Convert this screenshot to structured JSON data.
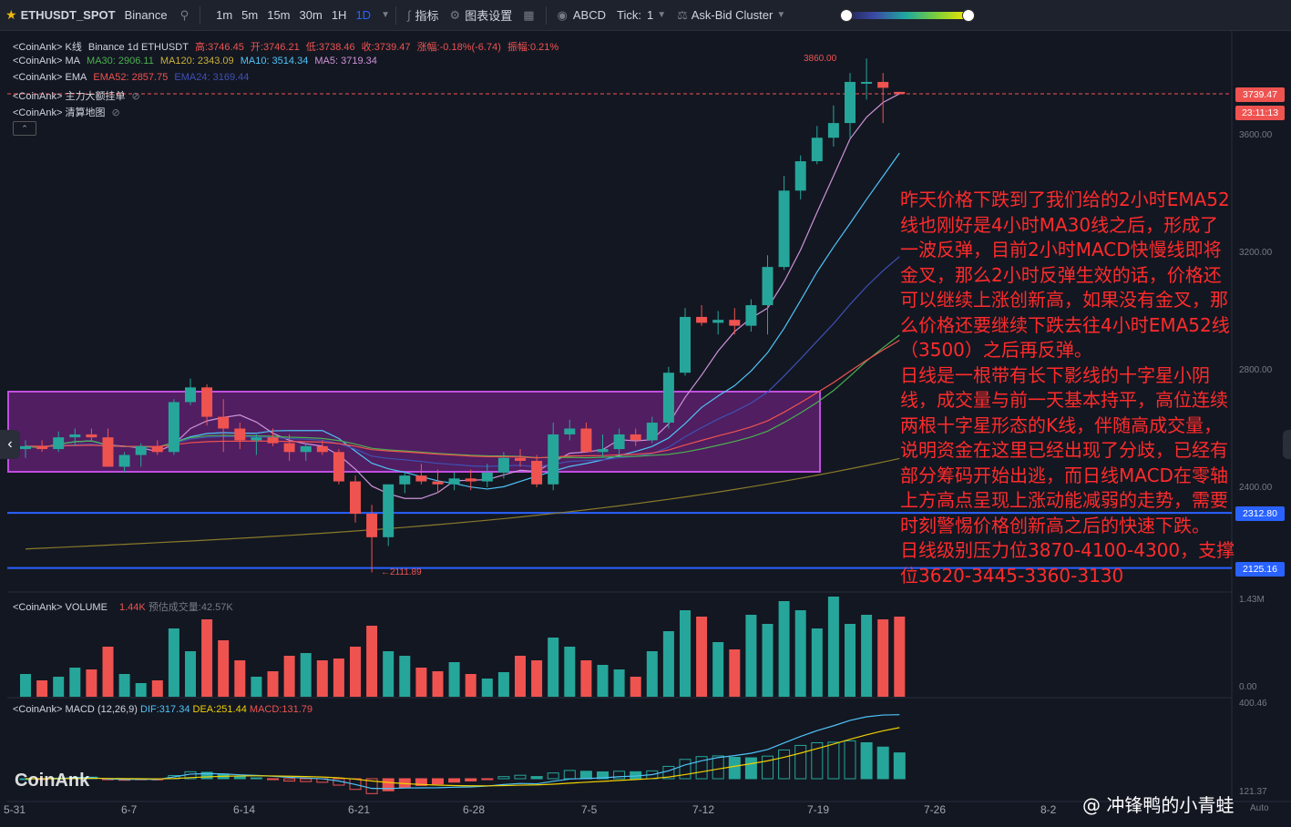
{
  "toolbar": {
    "symbol": "ETHUSDT_SPOT",
    "exchange": "Binance",
    "timeframes": [
      "1m",
      "5m",
      "15m",
      "30m",
      "1H",
      "1D"
    ],
    "active_timeframe": "1D",
    "indicators_label": "指标",
    "settings_label": "图表设置",
    "abcd_label": "ABCD",
    "tick_label": "Tick:",
    "tick_value": "1",
    "cluster_label": "Ask-Bid Cluster"
  },
  "legends": {
    "kline": {
      "prefix": "<CoinAnk> K线",
      "source": "Binance 1d ETHUSDT",
      "high": "高:3746.45",
      "open": "开:3746.21",
      "low": "低:3738.46",
      "close": "收:3739.47",
      "change": "涨幅:-0.18%(-6.74)",
      "amplitude": "振幅:0.21%"
    },
    "ma": {
      "prefix": "<CoinAnk> MA",
      "ma30": "MA30: 2906.11",
      "ma120": "MA120: 2343.09",
      "ma10": "MA10: 3514.34",
      "ma5": "MA5: 3719.34"
    },
    "ema": {
      "prefix": "<CoinAnk> EMA",
      "ema52": "EMA52: 2857.75",
      "ema24": "EMA24: 3169.44"
    },
    "orders": {
      "prefix": "<CoinAnk> 主力大额挂单"
    },
    "liq": {
      "prefix": "<CoinAnk> 清算地图"
    },
    "volume": {
      "prefix": "<CoinAnk> VOLUME",
      "value": "1.44K",
      "estimate": "预估成交量:42.57K"
    },
    "macd": {
      "prefix": "<CoinAnk> MACD",
      "params": "(12,26,9)",
      "dif": "DIF:317.34",
      "dea": "DEA:251.44",
      "macd": "MACD:131.79"
    }
  },
  "price_tags": {
    "last_price": "3739.47",
    "countdown": "23:11:13",
    "level_1": "2312.80",
    "level_2": "2125.16",
    "high_mark": "3860.00",
    "low_mark": "2111.89"
  },
  "price_axis": [
    "3600.00",
    "3200.00",
    "2800.00",
    "2400.00"
  ],
  "volume_axis": [
    "1.43M",
    "0.00"
  ],
  "macd_axis": [
    "400.46",
    "121.37"
  ],
  "date_axis": [
    "5-31",
    "6-7",
    "6-14",
    "6-21",
    "6-28",
    "7-5",
    "7-12",
    "7-19",
    "7-26",
    "8-2",
    "Auto"
  ],
  "annotation": [
    "昨天价格下跌到了我们给的2小时EMA52线也刚好是4小时MA30线之后，形成了一波反弹，目前2小时MACD快慢线即将金叉，那么2小时反弹生效的话，价格还可以继续上涨创新高，如果没有金叉，那么价格还要继续下跌去往4小时EMA52线（3500）之后再反弹。",
    "日线是一根带有长下影线的十字星小阴线，成交量与前一天基本持平，高位连续两根十字星形态的K线，伴随高成交量，说明资金在这里已经出现了分歧，已经有部分筹码开始出逃，而日线MACD在零轴上方高点呈现上涨动能减弱的走势，需要时刻警惕价格创新高之后的快速下跌。",
    "日线级别压力位3870-4100-4300，支撑位3620-3445-3360-3130"
  ],
  "logo_text": "CoinAnk",
  "watermark": "@ 冲锋鸭的小青蛙",
  "colors": {
    "up": "#26a69a",
    "down": "#ef5350",
    "box": "#9c27b0",
    "support_line": "#2962ff"
  },
  "chart_data": {
    "type": "candlestick",
    "x": [
      "5-31",
      "6-1",
      "6-2",
      "6-3",
      "6-4",
      "6-5",
      "6-6",
      "6-7",
      "6-8",
      "6-9",
      "6-10",
      "6-11",
      "6-12",
      "6-13",
      "6-14",
      "6-15",
      "6-16",
      "6-17",
      "6-18",
      "6-19",
      "6-20",
      "6-21",
      "6-22",
      "6-23",
      "6-24",
      "6-25",
      "6-26",
      "6-27",
      "6-28",
      "6-29",
      "6-30",
      "7-1",
      "7-2",
      "7-3",
      "7-4",
      "7-5",
      "7-6",
      "7-7",
      "7-8",
      "7-9",
      "7-10",
      "7-11",
      "7-12",
      "7-13",
      "7-14",
      "7-15",
      "7-16",
      "7-17",
      "7-18",
      "7-19",
      "7-20",
      "7-21",
      "7-22",
      "7-23"
    ],
    "candles": [
      [
        2530,
        2560,
        2500,
        2540
      ],
      [
        2540,
        2560,
        2520,
        2530
      ],
      [
        2530,
        2590,
        2520,
        2570
      ],
      [
        2570,
        2600,
        2540,
        2580
      ],
      [
        2580,
        2600,
        2560,
        2570
      ],
      [
        2570,
        2600,
        2470,
        2470
      ],
      [
        2470,
        2520,
        2450,
        2510
      ],
      [
        2510,
        2550,
        2470,
        2540
      ],
      [
        2540,
        2560,
        2510,
        2520
      ],
      [
        2520,
        2700,
        2510,
        2690
      ],
      [
        2690,
        2770,
        2680,
        2740
      ],
      [
        2740,
        2750,
        2610,
        2640
      ],
      [
        2640,
        2700,
        2520,
        2600
      ],
      [
        2600,
        2620,
        2530,
        2560
      ],
      [
        2560,
        2580,
        2510,
        2570
      ],
      [
        2570,
        2600,
        2540,
        2550
      ],
      [
        2550,
        2580,
        2490,
        2520
      ],
      [
        2520,
        2550,
        2490,
        2540
      ],
      [
        2540,
        2560,
        2510,
        2520
      ],
      [
        2520,
        2530,
        2410,
        2420
      ],
      [
        2420,
        2440,
        2280,
        2310
      ],
      [
        2310,
        2340,
        2110,
        2230
      ],
      [
        2230,
        2380,
        2200,
        2410
      ],
      [
        2410,
        2450,
        2380,
        2440
      ],
      [
        2440,
        2480,
        2410,
        2420
      ],
      [
        2420,
        2460,
        2380,
        2410
      ],
      [
        2410,
        2450,
        2390,
        2430
      ],
      [
        2430,
        2460,
        2390,
        2420
      ],
      [
        2420,
        2480,
        2400,
        2450
      ],
      [
        2450,
        2520,
        2430,
        2500
      ],
      [
        2500,
        2530,
        2470,
        2490
      ],
      [
        2490,
        2510,
        2400,
        2410
      ],
      [
        2410,
        2620,
        2390,
        2580
      ],
      [
        2580,
        2630,
        2560,
        2600
      ],
      [
        2600,
        2620,
        2520,
        2520
      ],
      [
        2520,
        2580,
        2500,
        2530
      ],
      [
        2530,
        2600,
        2510,
        2580
      ],
      [
        2580,
        2600,
        2540,
        2560
      ],
      [
        2560,
        2640,
        2550,
        2620
      ],
      [
        2620,
        2810,
        2600,
        2790
      ],
      [
        2790,
        3010,
        2780,
        2980
      ],
      [
        2980,
        3020,
        2950,
        2960
      ],
      [
        2960,
        3000,
        2920,
        2970
      ],
      [
        2970,
        3010,
        2920,
        2950
      ],
      [
        2950,
        3040,
        2930,
        3020
      ],
      [
        3020,
        3190,
        2920,
        3150
      ],
      [
        3150,
        3460,
        3140,
        3410
      ],
      [
        3410,
        3530,
        3380,
        3510
      ],
      [
        3510,
        3630,
        3500,
        3590
      ],
      [
        3590,
        3700,
        3560,
        3640
      ],
      [
        3640,
        3810,
        3590,
        3780
      ],
      [
        3780,
        3860,
        3720,
        3780
      ],
      [
        3780,
        3810,
        3640,
        3760
      ],
      [
        3746,
        3746,
        3738,
        3739
      ]
    ],
    "volume": [
      0.25,
      0.18,
      0.22,
      0.32,
      0.3,
      0.55,
      0.25,
      0.15,
      0.18,
      0.75,
      0.5,
      0.85,
      0.62,
      0.4,
      0.22,
      0.28,
      0.45,
      0.48,
      0.4,
      0.42,
      0.55,
      0.78,
      0.5,
      0.45,
      0.32,
      0.28,
      0.38,
      0.25,
      0.2,
      0.27,
      0.45,
      0.4,
      0.65,
      0.55,
      0.4,
      0.35,
      0.3,
      0.22,
      0.5,
      0.72,
      0.95,
      0.88,
      0.6,
      0.52,
      0.9,
      0.8,
      1.05,
      0.95,
      0.75,
      1.1,
      0.8,
      0.9,
      0.85,
      0.88
    ],
    "ylim": [
      2100,
      3900
    ],
    "horizontal_levels": [
      2312.8,
      2125.16
    ],
    "last_price": 3739.47
  }
}
